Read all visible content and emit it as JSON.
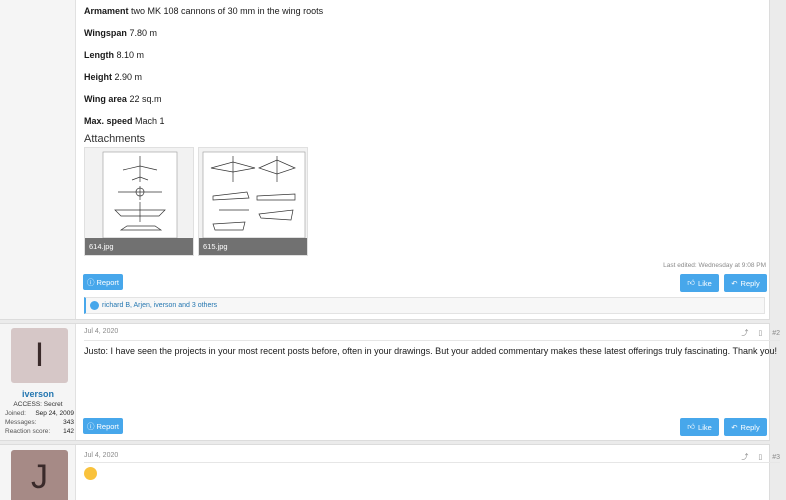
{
  "post1": {
    "specs": [
      {
        "label": "Armament",
        "value": "two MK 108 cannons of 30 mm in the wing roots"
      },
      {
        "label": "Wingspan",
        "value": "7.80 m"
      },
      {
        "label": "Length",
        "value": "8.10 m"
      },
      {
        "label": "Height",
        "value": "2.90 m"
      },
      {
        "label": "Wing area",
        "value": "22 sq.m"
      },
      {
        "label": "Max. speed",
        "value": "Mach 1"
      }
    ],
    "attachments_title": "Attachments",
    "attachments": [
      {
        "file": "614.jpg"
      },
      {
        "file": "615.jpg"
      }
    ],
    "last_edited": "Last edited: Wednesday at 9:08 PM",
    "report_label": "Report",
    "like_label": "Like",
    "reply_label": "Reply",
    "reactions": "richard B, Arjen, iverson and 3 others"
  },
  "post2": {
    "avatar_letter": "I",
    "avatar_color": "#d6c7c7",
    "username": "iverson",
    "user_title": "ACCESS: Secret",
    "stats": [
      {
        "label": "Joined:",
        "value": "Sep 24, 2009"
      },
      {
        "label": "Messages:",
        "value": "343"
      },
      {
        "label": "Reaction score:",
        "value": "142"
      }
    ],
    "date": "Jul 4, 2020",
    "number": "#2",
    "text": "Justo: I have seen the projects in your most recent posts before, often in your drawings. But your added commentary makes these latest offerings truly fascinating. Thank you!",
    "report_label": "Report",
    "like_label": "Like",
    "reply_label": "Reply"
  },
  "post3": {
    "avatar_letter": "J",
    "avatar_color": "#a68a86",
    "date": "Jul 4, 2020",
    "number": "#3"
  },
  "colors": {
    "accent": "#47a7eb",
    "link": "#2577b1"
  }
}
